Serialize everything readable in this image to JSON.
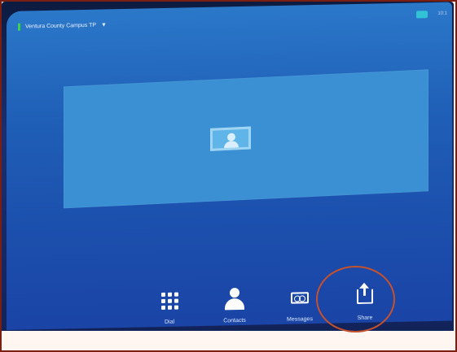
{
  "status": {
    "site_name": "Ventura County Campus TP",
    "dropdown_icon": "caret-down",
    "time": "10:1"
  },
  "self_view": {
    "placeholder_icon": "contact-card-icon"
  },
  "nav": {
    "items": [
      {
        "label": "Dial",
        "icon": "dial-pad-icon"
      },
      {
        "label": "Contacts",
        "icon": "person-icon"
      },
      {
        "label": "Messages",
        "icon": "voicemail-icon"
      },
      {
        "label": "Share",
        "icon": "share-icon"
      }
    ]
  },
  "annotation": {
    "highlight_color": "#c5512d"
  }
}
